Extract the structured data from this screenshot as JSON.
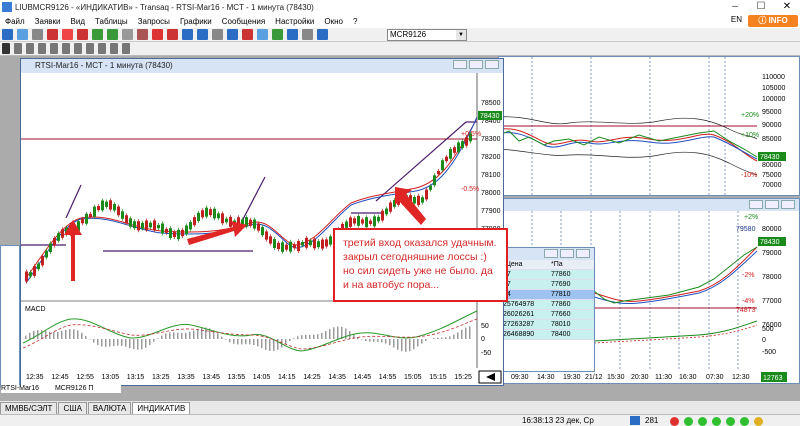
{
  "window_title": "LIUBMCR9126 - «ИНДИКАТИВ» - Transaq - RTSI-Mar16 - MCT - 1 минута (78430)",
  "menu": [
    "Файл",
    "Заявки",
    "Вид",
    "Таблицы",
    "Запросы",
    "Графики",
    "Сообщения",
    "Настройки",
    "Окно",
    "?"
  ],
  "lang": "EN",
  "info_label": "INFO",
  "symbol_box": "MCR9126",
  "main_chart": {
    "title": "RTSI-Mar16 - MCT - 1 минута (78430)",
    "y_ticks": [
      "78500",
      "78400",
      "78300",
      "78200",
      "78100",
      "78000",
      "77900",
      "77800"
    ],
    "price_label": "78430",
    "pct_labels": [
      "+0.5%",
      "-0.5%"
    ],
    "x_ticks": [
      "12:35",
      "12:45",
      "12:55",
      "13:05",
      "13:15",
      "13:25",
      "13:35",
      "13:45",
      "13:55",
      "14:05",
      "14:15",
      "14:25",
      "14:35",
      "14:45",
      "14:55",
      "15:05",
      "15:15",
      "15:25"
    ],
    "indicator_label": "MACD",
    "macd_ticks": [
      "50",
      "0",
      "-50"
    ]
  },
  "right_top_chart": {
    "y_ticks": [
      "110000",
      "105000",
      "100000",
      "95000",
      "90000",
      "85000",
      "80000",
      "75000",
      "70000",
      "65000"
    ],
    "price_label": "78430",
    "pct_labels": [
      "+20%",
      "+10%",
      "-10%"
    ]
  },
  "right_bottom_chart": {
    "y_ticks": [
      "80000",
      "79000",
      "78000",
      "77000",
      "76000",
      "75000"
    ],
    "labels": [
      "+2%",
      "79580",
      "78430",
      "-2%",
      "-4%",
      "74873"
    ],
    "macd_ticks": [
      "500",
      "0",
      "-500"
    ],
    "x_ticks": [
      "09:30",
      "14:30",
      "19:30",
      "21/12",
      "15:30",
      "20:30",
      "11:30",
      "16:30",
      "07:30",
      "12:30"
    ],
    "corner_label": "12763"
  },
  "table": {
    "headers": [
      "*Цена",
      "*Па"
    ],
    "rows": [
      [
        "57",
        "77860"
      ],
      [
        "77",
        "77690"
      ],
      [
        "14",
        "77810"
      ],
      [
        "25764978",
        "77860"
      ],
      [
        "26026261",
        "77660"
      ],
      [
        "27263287",
        "78010"
      ],
      [
        "26468890",
        "78400"
      ]
    ]
  },
  "annotation": "третий вход оказался удачным. закрыл сегодняшние лоссы :) но сил сидеть уже не было. да и на автобус пора...",
  "left_panel_row_label": "RTSI-Mar16",
  "left_panel_row_value": "MCR9126 П",
  "bottom_tabs": [
    "ММВБ/СЭЛТ",
    "США",
    "ВАЛЮТА",
    "ИНДИКАТИВ"
  ],
  "status": {
    "clock": "16:38:13  23 дек, Ср",
    "count": "281"
  },
  "colors": {
    "accent": "#f58220",
    "annotation": "#d42a2a",
    "bull": "#1a8a1a",
    "bear": "#c02020",
    "price_line": "#a01030"
  }
}
